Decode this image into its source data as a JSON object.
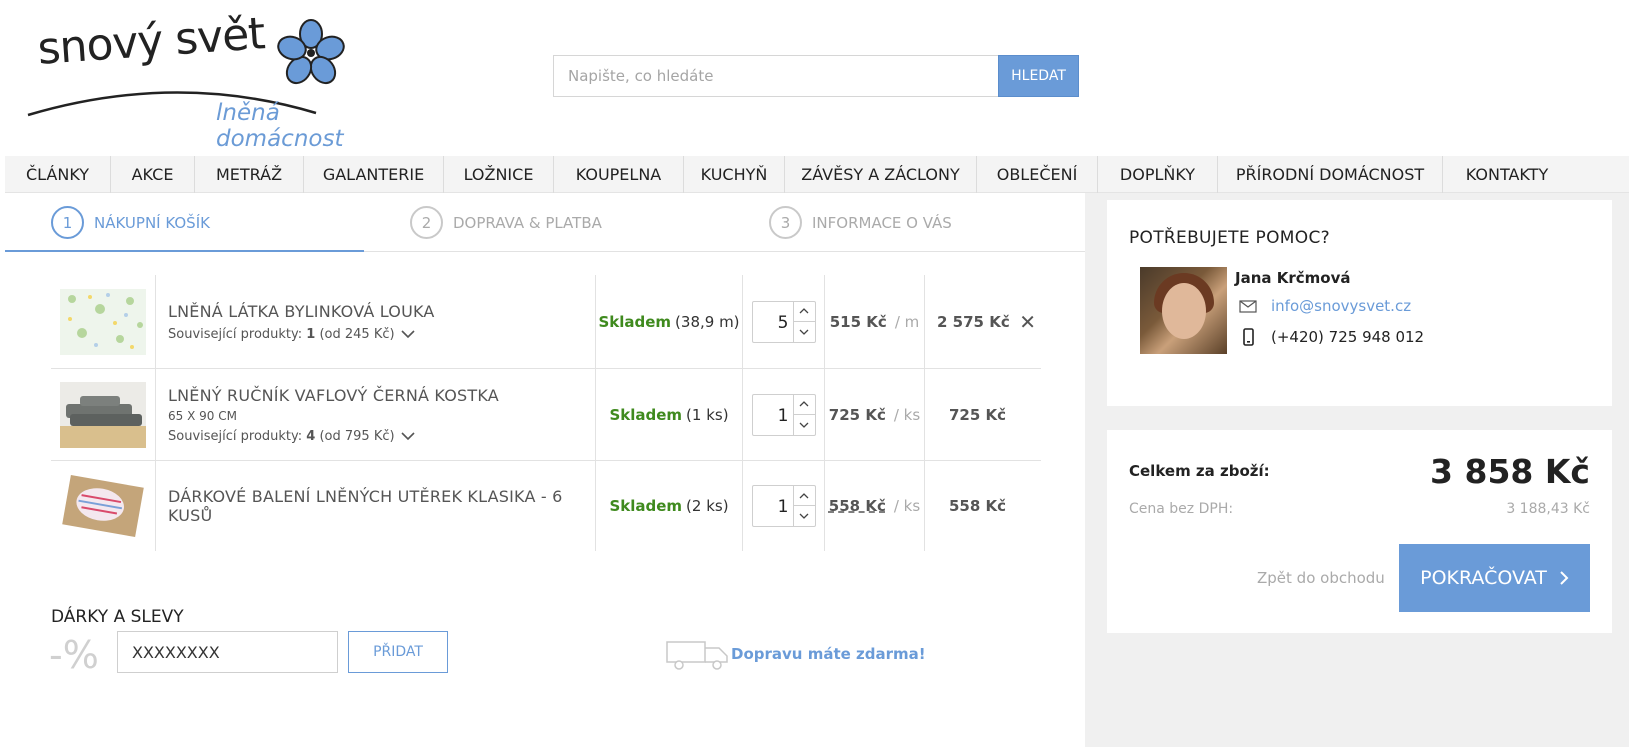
{
  "logo": {
    "brand": "snový svět",
    "tagline": "lněná domácnost"
  },
  "search": {
    "placeholder": "Napište, co hledáte",
    "button": "HLEDAT"
  },
  "nav": [
    "ČLÁNKY",
    "AKCE",
    "METRÁŽ",
    "GALANTERIE",
    "LOŽNICE",
    "KOUPELNA",
    "KUCHYŇ",
    "ZÁVĚSY A ZÁCLONY",
    "OBLEČENÍ",
    "DOPLŇKY",
    "PŘÍRODNÍ DOMÁCNOST",
    "KONTAKTY"
  ],
  "steps": [
    {
      "num": "1",
      "label": "NÁKUPNÍ KOŠÍK"
    },
    {
      "num": "2",
      "label": "DOPRAVA & PLATBA"
    },
    {
      "num": "3",
      "label": "INFORMACE O VÁS"
    }
  ],
  "cart": [
    {
      "name": "LNĚNÁ LÁTKA BYLINKOVÁ LOUKA",
      "sub": "",
      "related_prefix": "Související produkty: ",
      "related_count": "1",
      "related_price": "(od 245 Kč)",
      "stock": "Skladem",
      "stock_qty": "(38,9 m)",
      "qty": "5",
      "price": "515 Kč",
      "unit": "/ m",
      "total": "2 575 Kč"
    },
    {
      "name": "LNĚNÝ RUČNÍK VAFLOVÝ ČERNÁ KOSTKA",
      "sub": "65 X 90 CM",
      "related_prefix": "Související produkty: ",
      "related_count": "4",
      "related_price": "(od 795 Kč)",
      "stock": "Skladem",
      "stock_qty": "(1 ks)",
      "qty": "1",
      "price": "725 Kč",
      "unit": "/ ks",
      "total": "725 Kč"
    },
    {
      "name": "DÁRKOVÉ BALENÍ LNĚNÝCH UTĚREK KLASIKA - 6 KUSŮ",
      "sub": "",
      "stock": "Skladem",
      "stock_qty": "(2 ks)",
      "qty": "1",
      "price": "558 Kč",
      "unit": "/ ks",
      "total": "558 Kč"
    }
  ],
  "gifts": {
    "title": "DÁRKY A SLEVY",
    "symbol": "-%",
    "code_value": "XXXXXXXX",
    "add_button": "PŘIDAT",
    "free_shipping": "Dopravu máte zdarma!"
  },
  "help": {
    "title": "POTŘEBUJETE POMOC?",
    "name": "Jana Krčmová",
    "email": "info@snovysvet.cz",
    "phone": "(+420) 725 948 012"
  },
  "summary": {
    "total_label": "Celkem za zboží:",
    "total": "3 858 Kč",
    "vat_label": "Cena bez DPH:",
    "vat_value": "3 188,43 Kč",
    "back": "Zpět do obchodu",
    "continue": "POKRAČOVAT"
  },
  "colors": {
    "accent": "#6a9bd8",
    "stock": "#3f8a1e"
  }
}
